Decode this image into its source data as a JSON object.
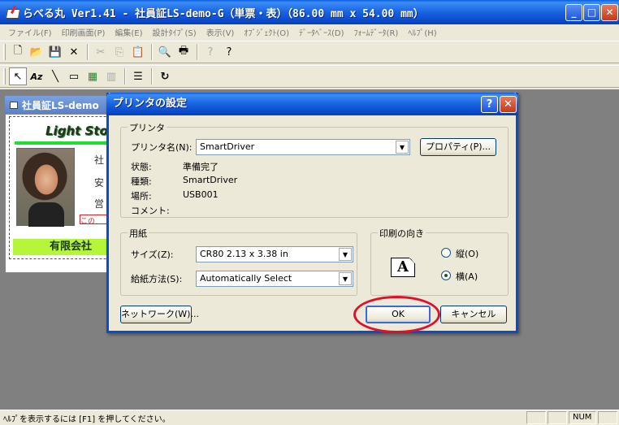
{
  "window": {
    "title": "らべる丸 Ver1.41 - 社員証LS-demo-G（単票・表）（86.00 mm x 54.00 mm）",
    "minimize": "_",
    "maximize": "□",
    "close": "✕"
  },
  "menu": [
    "ファイル(F)",
    "印刷画面(P)",
    "編集(E)",
    "設計ﾀｲﾌﾟ(S)",
    "表示(V)",
    "ｵﾌﾞｼﾞｪｸﾄ(O)",
    "ﾃﾞｰﾀﾍﾞｰｽ(D)",
    "ﾌｫｰﾑﾃﾞｰﾀ(R)",
    "ﾍﾙﾌﾟ(H)"
  ],
  "toolbar1": {
    "new": "🗋",
    "open": "📂",
    "save": "💾",
    "delete": "✕",
    "cut": "✂",
    "copy": "⎘",
    "paste": "📋",
    "preview": "🔍",
    "print": "🖶",
    "whatsthis": "?",
    "help": "?"
  },
  "toolbar2": {
    "pointer": "↖",
    "text": "Az",
    "line": "╲",
    "rect": "▭",
    "image": "▦",
    "barcode": "▥",
    "list": "☰",
    "refresh": "↻"
  },
  "child": {
    "title": "社員証LS-demo",
    "logo": "Light Sto",
    "frag1": "社",
    "frag2": "安",
    "frag3": "営",
    "red": "この",
    "footer": "有限会社"
  },
  "dialog": {
    "title": "プリンタの設定",
    "help": "?",
    "close": "✕",
    "printer_group": "プリンタ",
    "printer_name_label": "プリンタ名(N):",
    "printer_name_value": "SmartDriver",
    "properties_button": "プロパティ(P)...",
    "status_label": "状態:",
    "status_value": "準備完了",
    "type_label": "種類:",
    "type_value": "SmartDriver",
    "location_label": "場所:",
    "location_value": "USB001",
    "comment_label": "コメント:",
    "paper_group": "用紙",
    "size_label": "サイズ(Z):",
    "size_value": "CR80 2.13 x 3.38 in",
    "source_label": "給紙方法(S):",
    "source_value": "Automatically Select",
    "orientation_group": "印刷の向き",
    "orient_icon": "A",
    "portrait_label": "縦(O)",
    "landscape_label": "横(A)",
    "network_button": "ネットワーク(W)...",
    "ok_button": "OK",
    "cancel_button": "キャンセル"
  },
  "status": {
    "text": "ﾍﾙﾌﾟを表示するには [F1] を押してください。",
    "num": "NUM"
  },
  "accent_colors": {
    "titlebar": "#0a5fe0",
    "highlight": "#e0102a"
  }
}
